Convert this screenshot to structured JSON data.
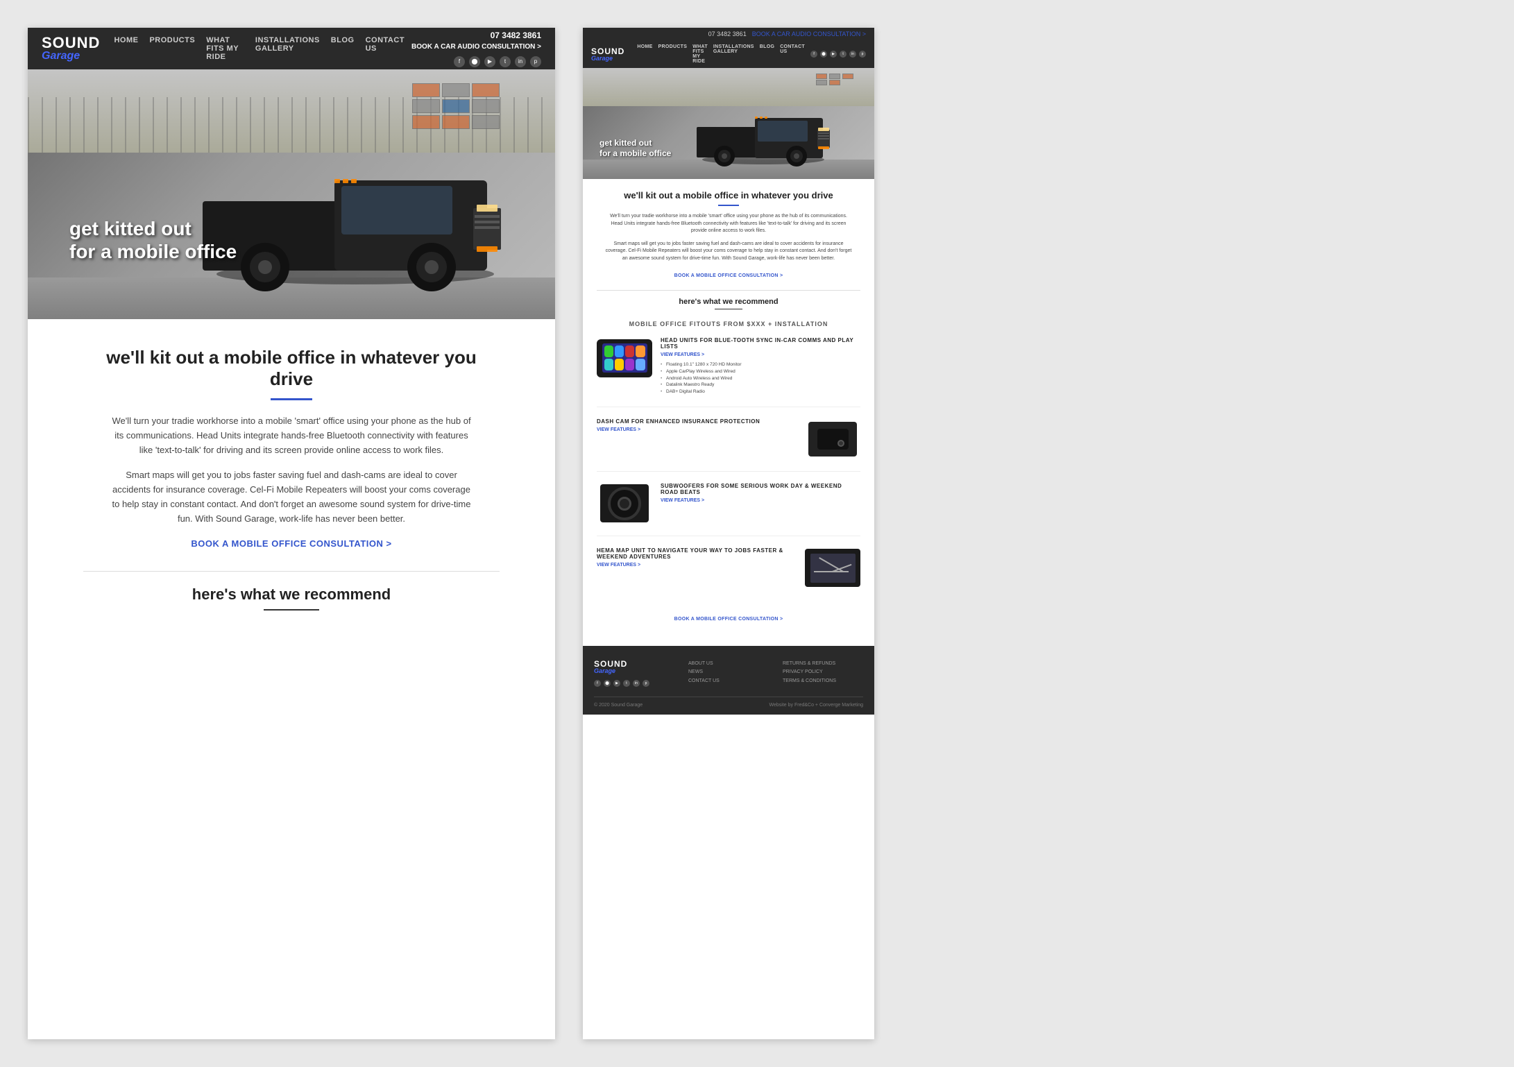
{
  "left": {
    "navbar": {
      "logo_sound": "SOUND",
      "logo_garage": "Garage",
      "links": [
        "HOME",
        "PRODUCTS",
        "WHAT FITS MY RIDE",
        "INSTALLATIONS GALLERY",
        "BLOG",
        "CONTACT US"
      ],
      "phone": "07 3482 3861",
      "cta": "BOOK A CAR AUDIO CONSULTATION >"
    },
    "hero": {
      "line1": "get kitted out",
      "line2": "for a mobile office"
    },
    "section": {
      "title": "we'll kit out a mobile office in whatever you drive",
      "para1": "We'll turn your tradie workhorse into a mobile 'smart' office using your phone as the hub of its communications. Head Units integrate hands-free Bluetooth connectivity with features like 'text-to-talk' for driving and its screen provide online access to work files.",
      "para2": "Smart maps will get you to jobs faster saving fuel and dash-cams are ideal to cover accidents for insurance coverage. Cel-Fi Mobile Repeaters will boost your coms coverage to help stay in constant contact. And don't forget an awesome sound system for drive-time fun. With Sound Garage, work-life has never been better.",
      "cta": "BOOK A MOBILE OFFICE CONSULTATION >",
      "recommend": "here's what we recommend"
    }
  },
  "right": {
    "navbar": {
      "logo_sound": "SOUND",
      "logo_garage": "Garage",
      "phone": "07 3482 3861",
      "cta": "BOOK A CAR AUDIO CONSULTATION >",
      "links": [
        "HOME",
        "PRODUCTS",
        "WHAT FITS MY RIDE",
        "INSTALLATIONS GALLERY",
        "BLOG",
        "CONTACT US"
      ]
    },
    "hero": {
      "line1": "get kitted out",
      "line2": "for a mobile office"
    },
    "section": {
      "title": "we'll kit out a mobile office in whatever you drive",
      "para1": "We'll turn your tradie workhorse into a mobile 'smart' office using your phone as the hub of its communications. Head Units integrate hands-free Bluetooth connectivity with features like 'text-to-talk' for driving and its screen provide online access to work files.",
      "para2": "Smart maps will get you to jobs faster saving fuel and dash-cams are ideal to cover accidents for insurance coverage. Cel-Fi Mobile Repeaters will boost your coms coverage to help stay in constant contact. And don't forget an awesome sound system for drive-time fun. With Sound Garage, work-life has never been better.",
      "cta": "BOOK A MOBILE OFFICE CONSULTATION >",
      "recommend": "here's what we recommend",
      "products_subtitle": "MOBILE OFFICE FITOUTS FROM $XXX + INSTALLATION",
      "cta_bottom": "BOOK A MOBILE OFFICE CONSULTATION >"
    },
    "products": [
      {
        "name": "HEAD UNITS FOR BLUE-TOOTH SYNC IN-CAR COMMS AND PLAY LISTS",
        "view": "VIEW FEATURES >",
        "bullets": [
          "Floating 10.1\" 1280 x 720 HD Monitor",
          "Apple CarPlay Wireless and Wired",
          "Android Auto Wireless and Wired",
          "Datalink Maestro Ready",
          "DAB+ Digital Radio"
        ]
      },
      {
        "name": "DASH CAM FOR ENHANCED INSURANCE PROTECTION",
        "view": "VIEW FEATURES >"
      },
      {
        "name": "SUBWOOFERS FOR SOME SERIOUS WORK DAY & WEEKEND ROAD BEATS",
        "view": "VIEW FEATURES >"
      },
      {
        "name": "HEMA MAP UNIT TO NAVIGATE YOUR WAY TO JOBS FASTER & WEEKEND ADVENTURES",
        "view": "VIEW FEATURES >"
      }
    ],
    "footer": {
      "col1": {
        "title": "",
        "logo_sound": "SOUND",
        "logo_garage": "Garage"
      },
      "col2": {
        "items": [
          "ABOUT US",
          "NEWS",
          "CONTACT US"
        ]
      },
      "col3": {
        "items": [
          "RETURNS & REFUNDS",
          "PRIVACY POLICY",
          "TERMS & CONDITIONS"
        ]
      },
      "copy": "© 2020 Sound Garage",
      "credit": "Website by Fred&Co + Converge Marketing"
    }
  }
}
